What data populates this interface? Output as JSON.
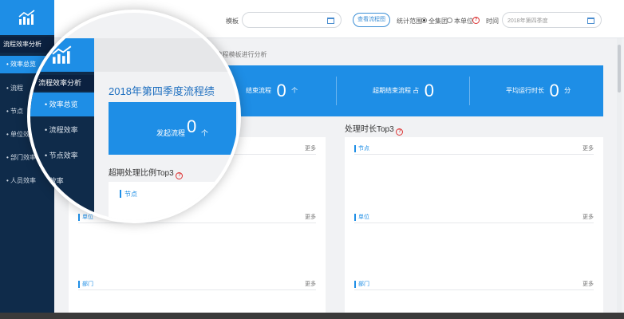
{
  "sidebar": {
    "section": "流程效率分析",
    "items": [
      {
        "label": "• 效率总览",
        "active": true
      },
      {
        "label": "• 流程"
      },
      {
        "label": "• 节点"
      },
      {
        "label": "• 单位效"
      },
      {
        "label": "• 部门效率"
      },
      {
        "label": "• 人员效率"
      }
    ]
  },
  "topbar": {
    "template_label": "模板",
    "view_button": "查看流程图",
    "scope_label": "统计范围",
    "scope_options": [
      "全集团",
      "本单位"
    ],
    "time_label": "时间",
    "time_value": "2018年第四季度"
  },
  "main": {
    "subtitle": "对0个流程模板进行分析",
    "stats": [
      {
        "label": "结束流程",
        "value": "0",
        "unit": "个"
      },
      {
        "label": "超期结束流程 占",
        "value": "0",
        "unit": ""
      },
      {
        "label": "平均运行时长",
        "value": "0",
        "unit": "分"
      }
    ],
    "right_title": "处理时长Top3",
    "more": "更多",
    "left_rows": [
      "单位",
      "部门"
    ],
    "right_rows": [
      "节点",
      "单位",
      "部门"
    ]
  },
  "magnifier": {
    "section": "流程效率分析",
    "items": [
      "• 效率总览",
      "• 流程效率",
      "• 节点效率",
      "• 效率"
    ],
    "title": "2018年第四季度流程绩",
    "start_label": "发起流程",
    "start_value": "0",
    "start_unit": "个",
    "overdue_title": "超期处理比例Top3",
    "node_label": "节点"
  },
  "colors": {
    "accent": "#1e8ee6",
    "sidebar": "#0f2b4a"
  }
}
